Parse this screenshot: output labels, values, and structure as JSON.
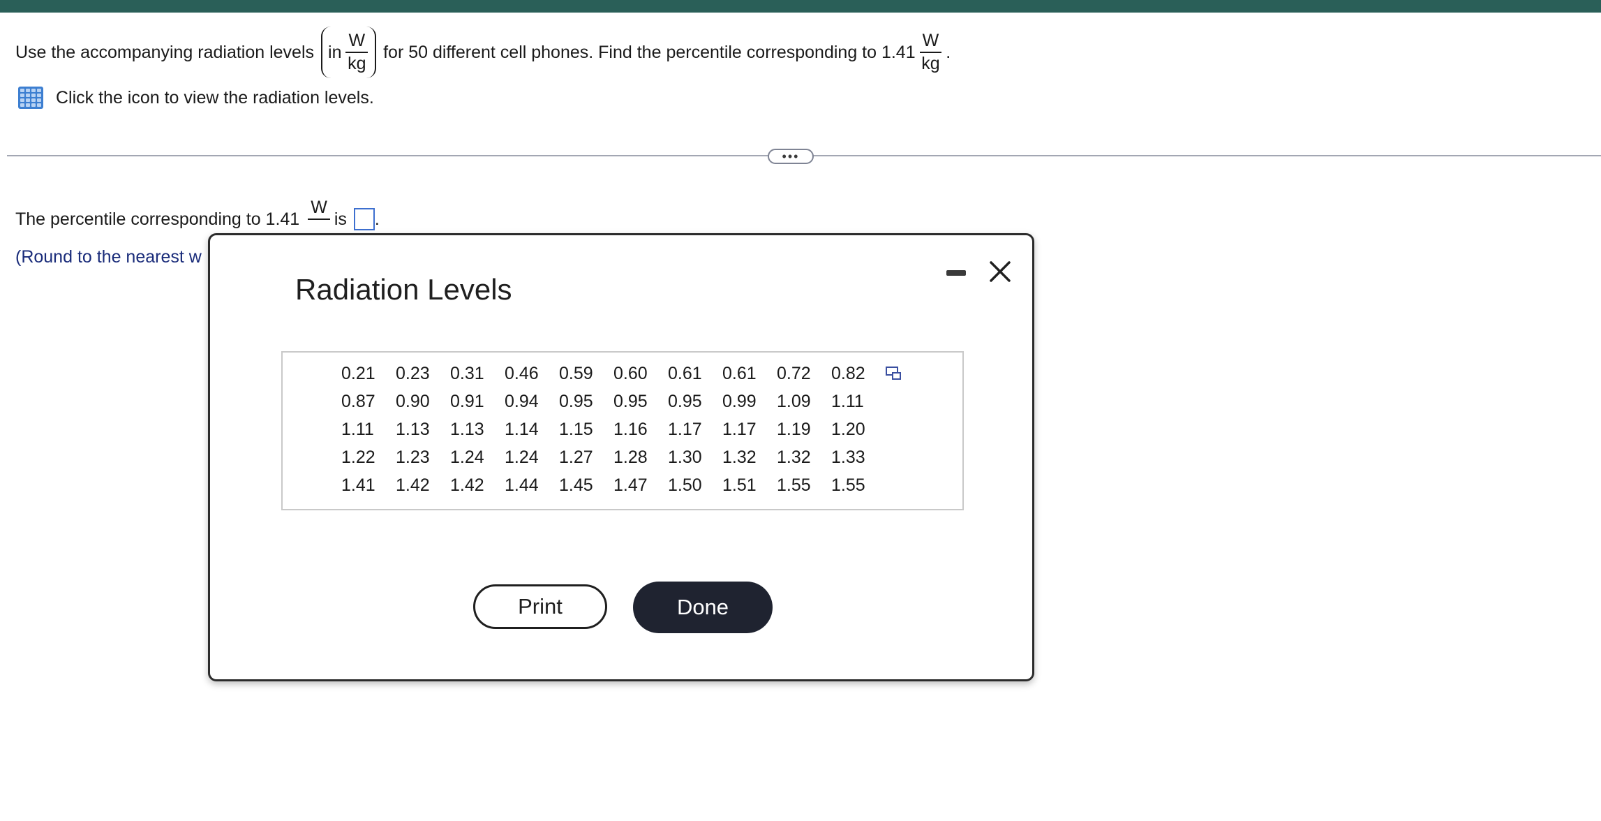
{
  "question": {
    "text_before": "Use the accompanying radiation levels",
    "paren_prefix": "in",
    "unit_num": "W",
    "unit_den": "kg",
    "text_middle": "for 50 different cell phones. Find the percentile corresponding to 1.41",
    "end_punct": "."
  },
  "click_text": "Click the icon to view the radiation levels.",
  "expand_label": "•••",
  "answer": {
    "prefix": "The percentile corresponding to 1.41",
    "unit_num": "W",
    "suffix": "is",
    "end": "."
  },
  "round_hint": "(Round to the nearest w",
  "modal": {
    "title": "Radiation Levels",
    "rows": [
      [
        "0.21",
        "0.23",
        "0.31",
        "0.46",
        "0.59",
        "0.60",
        "0.61",
        "0.61",
        "0.72",
        "0.82"
      ],
      [
        "0.87",
        "0.90",
        "0.91",
        "0.94",
        "0.95",
        "0.95",
        "0.95",
        "0.99",
        "1.09",
        "1.11"
      ],
      [
        "1.11",
        "1.13",
        "1.13",
        "1.14",
        "1.15",
        "1.16",
        "1.17",
        "1.17",
        "1.19",
        "1.20"
      ],
      [
        "1.22",
        "1.23",
        "1.24",
        "1.24",
        "1.27",
        "1.28",
        "1.30",
        "1.32",
        "1.32",
        "1.33"
      ],
      [
        "1.41",
        "1.42",
        "1.42",
        "1.44",
        "1.45",
        "1.47",
        "1.50",
        "1.51",
        "1.55",
        "1.55"
      ]
    ],
    "print_label": "Print",
    "done_label": "Done"
  },
  "colors": {
    "topbar": "#2a5f58",
    "link_text": "#1a2c7a",
    "done_bg": "#1f2330",
    "icon_blue": "#3d7fd1"
  }
}
